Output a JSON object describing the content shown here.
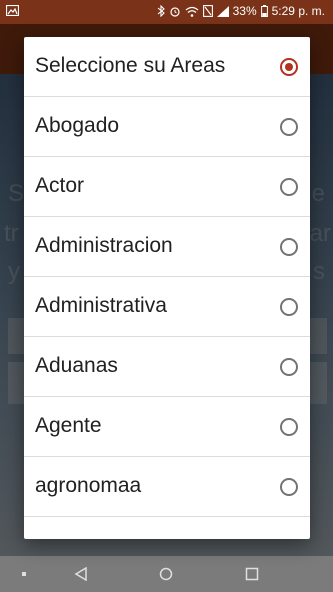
{
  "status_bar": {
    "battery": "33%",
    "time": "5:29 p. m."
  },
  "dialog": {
    "options": [
      {
        "label": "Seleccione su Areas",
        "checked": true
      },
      {
        "label": "Abogado",
        "checked": false
      },
      {
        "label": "Actor",
        "checked": false
      },
      {
        "label": "Administracion",
        "checked": false
      },
      {
        "label": "Administrativa",
        "checked": false
      },
      {
        "label": "Aduanas",
        "checked": false
      },
      {
        "label": "Agente",
        "checked": false
      },
      {
        "label": "agronomaa",
        "checked": false
      }
    ]
  },
  "background_text": {
    "line1_left": "S",
    "line1_right": "e",
    "line2_left": "tr",
    "line2_right": "ar",
    "line3_left": "y",
    "line3_right": "s"
  },
  "colors": {
    "accent": "#b3321f",
    "toolbar": "#8c3a17",
    "status_bar": "#7a3318"
  },
  "icons": {
    "status_left": "image-icon",
    "status_right": [
      "bluetooth-icon",
      "alarm-icon",
      "wifi-icon",
      "nfc-icon",
      "signal-icon",
      "battery-icon"
    ],
    "nav": [
      "dot-icon",
      "back-icon",
      "home-icon",
      "recents-icon"
    ]
  }
}
